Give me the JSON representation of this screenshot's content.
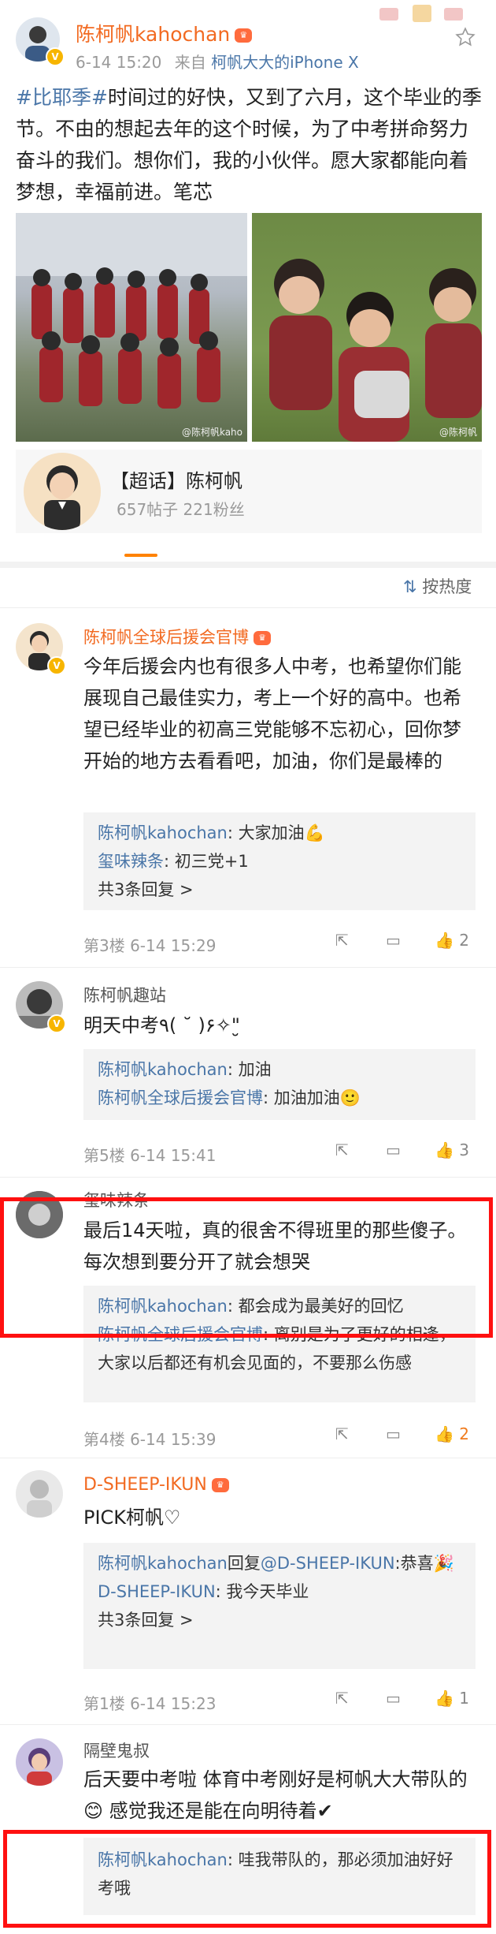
{
  "post": {
    "author": "陈柯帆kahochan",
    "time": "6-14 15:20",
    "source_prefix": "来自",
    "source": "柯帆大大的iPhone X",
    "hashtag": "#比耶季#",
    "text": "时间过的好快，又到了六月，这个毕业的季节。不由的想起去年的这个时候，为了中考拼命努力奋斗的我们。想你们，我的小伙伴。愿大家都能向着梦想，幸福前进。笔芯",
    "watermark1": "@陈柯帆kaho",
    "watermark2": "@陈柯帆"
  },
  "topic_card": {
    "title": "【超话】陈柯帆",
    "stats": "657帖子 221粉丝"
  },
  "sort": {
    "label": "按热度"
  },
  "comments": [
    {
      "user": "陈柯帆全球后援会官博",
      "text": "今年后援会内也有很多人中考，也希望你们能展现自己最佳实力，考上一个好的高中。也希望已经毕业的初高三党能够不忘初心，回你梦开始的地方去看看吧，加油，你们是最棒的",
      "replies": [
        {
          "user": "陈柯帆kahochan",
          "text": ": 大家加油💪"
        },
        {
          "user": "玺味辣条",
          "text": ": 初三党+1"
        }
      ],
      "more": "共3条回复 >",
      "floor": "第3楼 6-14 15:29",
      "likes": "2"
    },
    {
      "user": "陈柯帆趣站",
      "text": "明天中考٩( ˘ )۶✧\"̮",
      "replies": [
        {
          "user": "陈柯帆kahochan",
          "text": ": 加油"
        },
        {
          "user": "陈柯帆全球后援会官博",
          "text": ": 加油加油🙂"
        }
      ],
      "floor": "第5楼 6-14 15:41",
      "likes": "3"
    },
    {
      "user": "玺味辣条",
      "text": "最后14天啦，真的很舍不得班里的那些傻子。每次想到要分开了就会想哭",
      "replies": [
        {
          "user": "陈柯帆kahochan",
          "text": ": 都会成为最美好的回忆"
        },
        {
          "user": "陈柯帆全球后援会官博",
          "text": ": 离别是为了更好的相逢，大家以后都还有机会见面的，不要那么伤感"
        }
      ],
      "floor": "第4楼 6-14 15:39",
      "likes": "2"
    },
    {
      "user": "D-SHEEP-IKUN",
      "text": "PICK柯帆♡",
      "replies": [
        {
          "user": "陈柯帆kahochan",
          "mid": "回复",
          "user2": "@D-SHEEP-IKUN",
          "text": ":恭喜🎉"
        },
        {
          "user": "D-SHEEP-IKUN",
          "text": ": 我今天毕业"
        }
      ],
      "more": "共3条回复 >",
      "floor": "第1楼 6-14 15:23",
      "likes": "1"
    },
    {
      "user": "隔壁鬼叔",
      "text": "后天要中考啦 体育中考刚好是柯帆大大带队的😊 感觉我还是能在向明待着✔",
      "replies": [
        {
          "user": "陈柯帆kahochan",
          "text": ": 哇我带队的，那必须加油好好考哦"
        }
      ]
    }
  ],
  "colors": {
    "link": "#4a76a8",
    "highlight": "#ff1010",
    "like_active": "#f07b1d"
  }
}
